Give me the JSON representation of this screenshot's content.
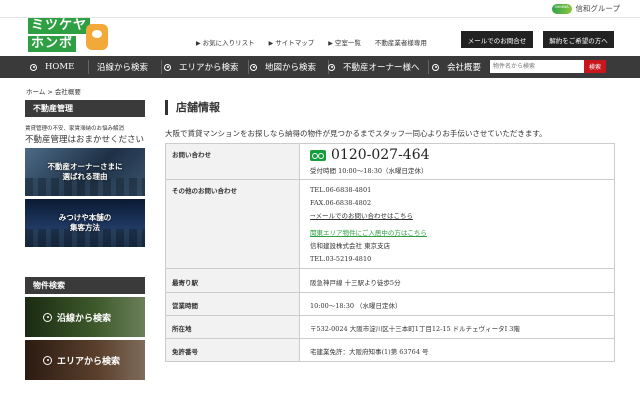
{
  "group": {
    "mark": "SHINWA",
    "label": "信和グループ"
  },
  "logo": {
    "line1": "ミツケヤ",
    "line2": "ホンポ"
  },
  "header": {
    "links": [
      {
        "arrow": "▶",
        "label": "お気に入りリスト"
      },
      {
        "arrow": "▶",
        "label": "サイトマップ"
      },
      {
        "arrow": "▶",
        "label": "空室一覧"
      },
      {
        "arrow": "",
        "label": "不動産業者様専用"
      }
    ],
    "contact_button": "メールでのお問合せ",
    "request_button": "解約をご希望の方へ"
  },
  "nav": {
    "items": [
      "HOME",
      "沿線から検索",
      "エリアから検索",
      "地図から検索",
      "不動産オーナー様へ",
      "会社概要"
    ],
    "search_placeholder": "物件名から検索",
    "search_button": "検索"
  },
  "breadcrumb": "ホーム > 会社概要",
  "sidebar": {
    "heading": "不動産管理",
    "desc1": "賃貸管理の不安、家賃滞納のお悩み解消",
    "desc2": "不動産管理はおまかせください",
    "banner1_line1": "不動産オーナーさまに",
    "banner1_line2": "選ばれる理由",
    "banner2_line1": "みつけや本舗の",
    "banner2_line2": "集客方法",
    "heading2": "物件検索",
    "search1": "沿線から検索",
    "search2": "エリアから検索"
  },
  "main": {
    "title": "店舗情報",
    "lead": "大阪で賃貸マンションをお探しなら納得の物件が見つかるまでスタッフ一同心よりお手伝いさせていただきます。",
    "rows": {
      "inquiry": {
        "label": "お問い合わせ",
        "tel": "0120-027-464",
        "hours": "受付時間 10:00～18:30（水曜日定休）"
      },
      "other": {
        "label": "その他のお問い合わせ",
        "tel": "TEL.06-6838-4801",
        "fax": "FAX.06-6838-4802",
        "mail_link": "→メールでのお問い合わせはこちら",
        "kanto_link": "関東エリア物件にご入居中の方はこちら",
        "company": "信和建設株式会社 東京支店",
        "company_tel": "TEL.03-5219-4810"
      },
      "station": {
        "label": "最寄り駅",
        "value": "阪急神戸線 十三駅より徒歩5分"
      },
      "hours": {
        "label": "営業時間",
        "value": "10:00～18:30 （水曜日定休）"
      },
      "address": {
        "label": "所在地",
        "value": "〒532-0024 大阪市淀川区十三本町1丁目12-15 ドルチェヴィータⅠ 3階"
      },
      "license": {
        "label": "免許番号",
        "value": "宅建業免許：大阪府知事(1)第 63764 号"
      }
    }
  },
  "colors": {
    "accent_green": "#2ea043",
    "nav_bg": "#3a3a3a",
    "search_red": "#c8161d"
  }
}
